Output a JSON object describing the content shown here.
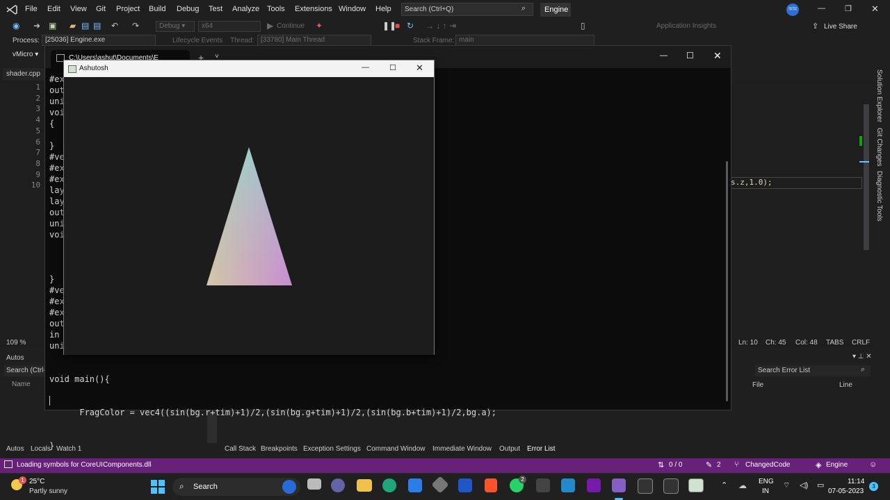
{
  "menu": {
    "items": [
      "File",
      "Edit",
      "View",
      "Git",
      "Project",
      "Build",
      "Debug",
      "Test",
      "Analyze",
      "Tools",
      "Extensions",
      "Window",
      "Help"
    ],
    "search_placeholder": "Search (Ctrl+Q)",
    "solution_name": "Engine",
    "avatar": "আম"
  },
  "toolbar": {
    "config": "Debug",
    "platform": "x64",
    "continue": "Continue",
    "app_insights": "Application Insights",
    "live_share": "Live Share"
  },
  "process_bar": {
    "process_label": "Process:",
    "process_value": "[25036] Engine.exe",
    "lifecycle": "Lifecycle Events",
    "thread_label": "Thread:",
    "thread_value": "[33780] Main Thread",
    "stackframe_label": "Stack Frame:",
    "stackframe_value": "main"
  },
  "editor": {
    "scope": "vMicro",
    "file_tab": "shader.cpp",
    "line_numbers": [
      "1",
      "2",
      "3",
      "4",
      "5",
      "6",
      "7",
      "8",
      "9",
      "10"
    ],
    "right_code": "s.z,1.0);",
    "zoom": "109 %",
    "status": {
      "ln": "Ln: 10",
      "ch": "Ch: 45",
      "col": "Col: 48",
      "tabs": "TABS",
      "crlf": "CRLF"
    }
  },
  "terminal": {
    "title": "C:\\Users\\ashut\\Documents\\E",
    "lines": [
      "#ex",
      "out",
      "uni",
      "voi",
      "{",
      "",
      "}",
      "#ve",
      "#ex",
      "#ex",
      "lay",
      "lay",
      "out",
      "uni",
      "voi",
      "",
      "",
      "",
      "}",
      "#ve",
      "#ex",
      "#ex",
      "out",
      "in ",
      "uni"
    ],
    "line_main": "void main(){",
    "line_frag": "      FragColor = vec4((sin(bg.r+tim)+1)/2,(sin(bg.g+tim)+1)/2,(sin(bg.b+tim)+1)/2,bg.a);",
    "line_close": "}"
  },
  "gl_window": {
    "title": "Ashutosh"
  },
  "autos": {
    "title": "Autos",
    "search_placeholder": "Search (Ctrl-",
    "col_name": "Name"
  },
  "error_list": {
    "search_placeholder": "Search Error List",
    "col_file": "File",
    "col_line": "Line"
  },
  "bottom_tabs_left": [
    "Autos",
    "Locals",
    "Watch 1"
  ],
  "bottom_tabs_right": [
    "Call Stack",
    "Breakpoints",
    "Exception Settings",
    "Command Window",
    "Immediate Window",
    "Output",
    "Error List"
  ],
  "right_panel": [
    "Solution Explorer",
    "Git Changes",
    "Diagnostic Tools"
  ],
  "statusbar": {
    "message": "Loading symbols for CoreUIComponents.dll",
    "errors": "0 / 0",
    "changes": "2",
    "branch": "ChangedCode",
    "repo": "Engine"
  },
  "taskbar": {
    "weather_temp": "25°C",
    "weather_desc": "Partly sunny",
    "weather_badge": "1",
    "search": "Search",
    "lang1": "ENG",
    "lang2": "IN",
    "time": "11:14",
    "date": "07-05-2023",
    "notif": "3",
    "whatsapp_badge": "2"
  },
  "colors": {
    "status_purple": "#68217a",
    "accent": "#0078d4"
  }
}
